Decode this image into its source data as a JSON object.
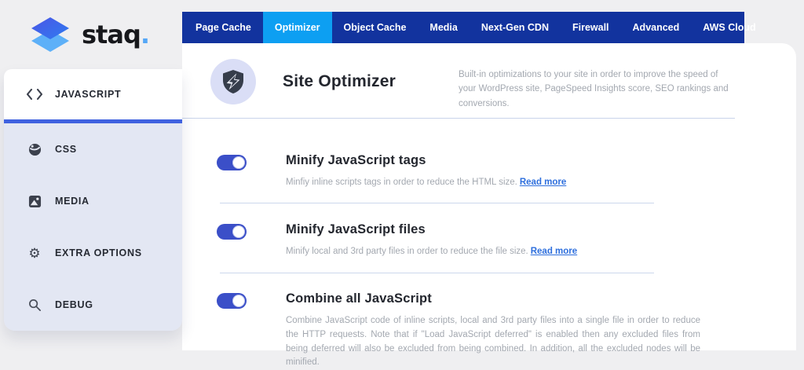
{
  "logo": {
    "text": "staq",
    "dot": "."
  },
  "nav": {
    "tabs": [
      {
        "label": "Page Cache",
        "active": false
      },
      {
        "label": "Optimizer",
        "active": true
      },
      {
        "label": "Object Cache",
        "active": false
      },
      {
        "label": "Media",
        "active": false
      },
      {
        "label": "Next-Gen CDN",
        "active": false
      },
      {
        "label": "Firewall",
        "active": false
      },
      {
        "label": "Advanced",
        "active": false
      },
      {
        "label": "AWS Cloud",
        "active": false
      }
    ]
  },
  "sidebar": {
    "items": [
      {
        "label": "JAVASCRIPT",
        "icon": "code-icon",
        "active": true
      },
      {
        "label": "CSS",
        "icon": "css-ball-icon",
        "active": false
      },
      {
        "label": "MEDIA",
        "icon": "image-icon",
        "active": false
      },
      {
        "label": "EXTRA OPTIONS",
        "icon": "gear-icon",
        "active": false
      },
      {
        "label": "DEBUG",
        "icon": "magnifier-icon",
        "active": false
      }
    ]
  },
  "header": {
    "title": "Site Optimizer",
    "icon": "shield-bolt-icon",
    "description": "Built-in optimizations to your site in order to improve the speed of your WordPress site, PageSpeed Insights score, SEO rankings and conversions."
  },
  "settings": [
    {
      "title": "Minify JavaScript tags",
      "description": "Minfiy inline scripts tags in order to reduce the HTML size.",
      "read_more": "Read more",
      "enabled": true
    },
    {
      "title": "Minify JavaScript files",
      "description": "Minify local and 3rd party files in order to reduce the file size.",
      "read_more": "Read more",
      "enabled": true
    },
    {
      "title": "Combine all JavaScript",
      "description": "Combine JavaScript code of inline scripts, local and 3rd party files into a single file in order to reduce the HTTP requests. Note that if \"Load JavaScript deferred\" is enabled then any excluded files from being deferred will also be excluded from being combined. In addition, all the excluded nodes will be minified.",
      "enabled": true
    }
  ],
  "colors": {
    "nav_bg": "#12339e",
    "nav_active": "#0d9ff2",
    "toggle_on": "#3b4fc8",
    "accent_bar": "#3f62e0",
    "link": "#2e6fdd",
    "sidebar_bg": "#e3e7f3",
    "page_bg": "#efeff1",
    "divider": "#ccd7ec",
    "logo_dot": "#55a7f7"
  }
}
